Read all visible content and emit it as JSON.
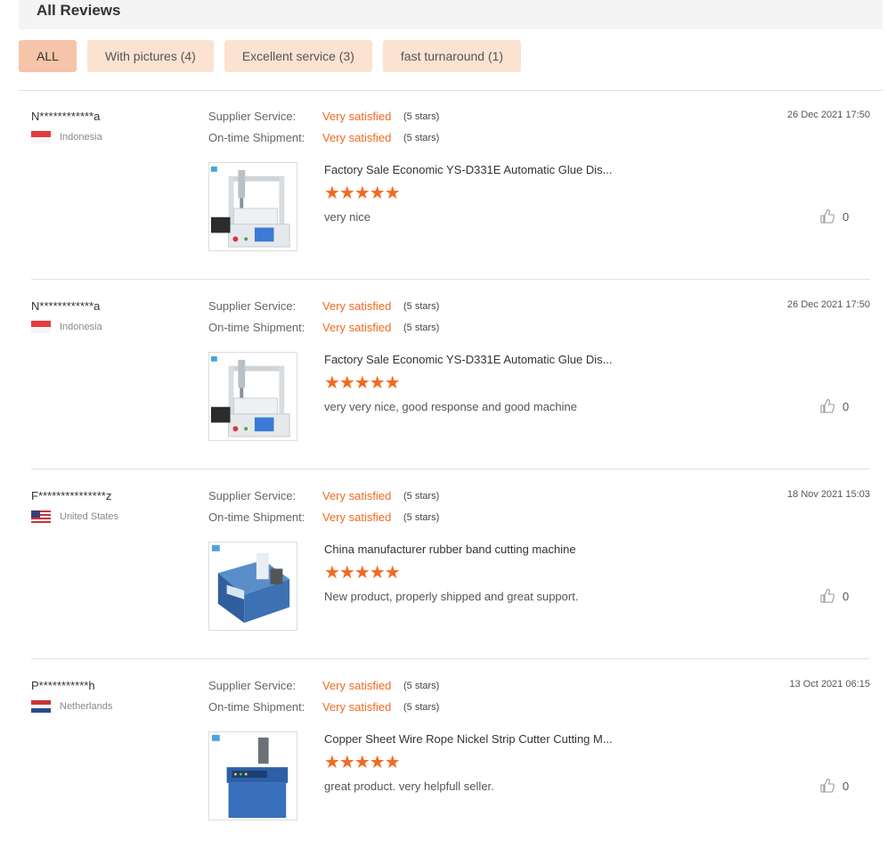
{
  "header": {
    "title": "All Reviews"
  },
  "filters": [
    {
      "label": "ALL",
      "active": true
    },
    {
      "label": "With pictures (4)"
    },
    {
      "label": "Excellent service (3)"
    },
    {
      "label": "fast turnaround (1)"
    }
  ],
  "labels": {
    "supplier_service": "Supplier Service:",
    "ontime_shipment": "On-time Shipment:",
    "star_glyphs": "★★★★★"
  },
  "colors": {
    "accent": "#f26a21",
    "chip_bg": "#fbe2d1",
    "chip_active_bg": "#f6c4a8"
  },
  "reviews": [
    {
      "user": "N************a",
      "country": "Indonesia",
      "flag": "indonesia-flag",
      "supplier_service": "Very satisfied",
      "supplier_service_stars": "(5 stars)",
      "shipment": "Very satisfied",
      "shipment_stars": "(5 stars)",
      "date": "26 Dec 2021 17:50",
      "product": "Factory Sale Economic YS-D331E Automatic Glue Dis...",
      "rating": 5,
      "comment": "very nice",
      "likes": "0",
      "image": "glue-dispenser-machine"
    },
    {
      "user": "N************a",
      "country": "Indonesia",
      "flag": "indonesia-flag",
      "supplier_service": "Very satisfied",
      "supplier_service_stars": "(5 stars)",
      "shipment": "Very satisfied",
      "shipment_stars": "(5 stars)",
      "date": "26 Dec 2021 17:50",
      "product": "Factory Sale Economic YS-D331E Automatic Glue Dis...",
      "rating": 5,
      "comment": "very very nice, good response and good machine",
      "likes": "0",
      "image": "glue-dispenser-machine"
    },
    {
      "user": "F***************z",
      "country": "United States",
      "flag": "usa-flag",
      "supplier_service": "Very satisfied",
      "supplier_service_stars": "(5 stars)",
      "shipment": "Very satisfied",
      "shipment_stars": "(5 stars)",
      "date": "18 Nov 2021 15:03",
      "product": "China manufacturer rubber band cutting machine",
      "rating": 5,
      "comment": "New product, properly shipped and great support.",
      "likes": "0",
      "image": "blue-cutting-machine"
    },
    {
      "user": "P***********h",
      "country": "Netherlands",
      "flag": "netherlands-flag",
      "supplier_service": "Very satisfied",
      "supplier_service_stars": "(5 stars)",
      "shipment": "Very satisfied",
      "shipment_stars": "(5 stars)",
      "date": "13 Oct 2021 06:15",
      "product": "Copper Sheet Wire Rope Nickel Strip Cutter Cutting M...",
      "rating": 5,
      "comment": "great product. very helpfull seller.",
      "likes": "0",
      "image": "strip-cutter-machine"
    }
  ]
}
